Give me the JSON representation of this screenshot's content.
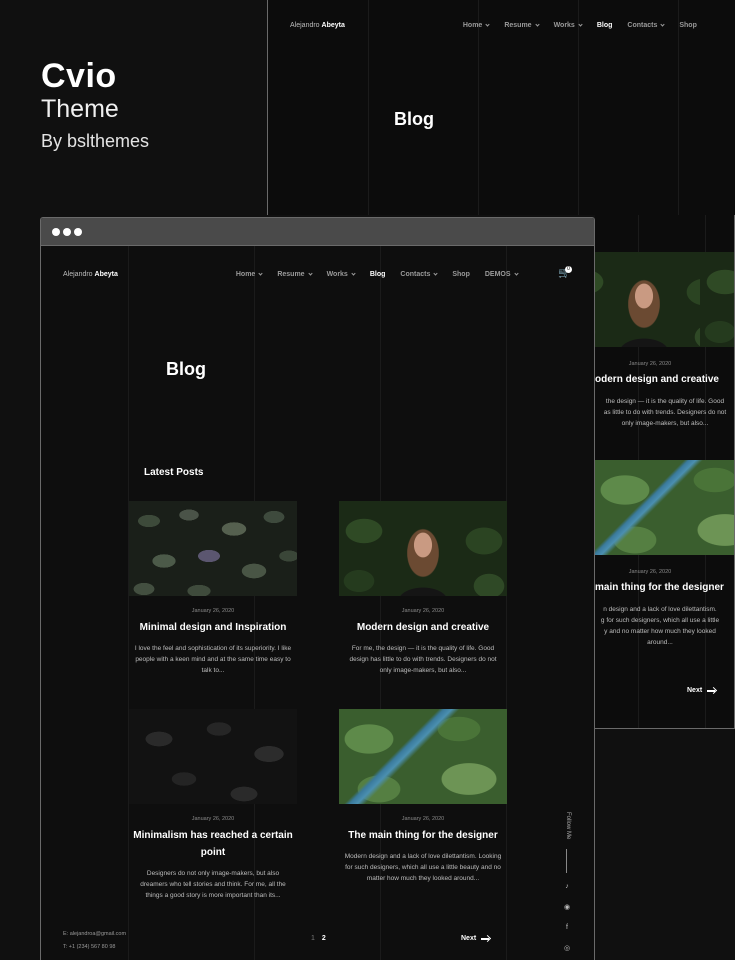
{
  "promo": {
    "brand": "Cvio",
    "theme": "Theme",
    "by": "By bslthemes"
  },
  "site": {
    "logo_first": "Alejandro",
    "logo_last": "Abeyta",
    "nav": [
      "Home",
      "Resume",
      "Works",
      "Blog",
      "Contacts",
      "Shop",
      "DEMOS"
    ],
    "active_nav": "Blog",
    "cart_count": "0",
    "page_title": "Blog",
    "section_title": "Latest Posts"
  },
  "posts": [
    {
      "date": "January 26, 2020",
      "title": "Minimal design and Inspiration",
      "excerpt": "I love the feel and sophistication of its superiority. I like people with a keen mind and at the same time easy to talk to..."
    },
    {
      "date": "January 26, 2020",
      "title": "Modern design and creative",
      "excerpt": "For me, the design — it is the quality of life. Good design has little to do with trends. Designers do not only image-makers, but also..."
    },
    {
      "date": "January 26, 2020",
      "title": "Minimalism has reached a certain point",
      "excerpt": "Designers do not only image-makers, but also dreamers who tell stories and think. For me, all the things a good story is more important than its..."
    },
    {
      "date": "January 26, 2020",
      "title": "The main thing for the designer",
      "excerpt": "Modern design and a lack of love dilettantism. Looking for such designers, which all use a little beauty and no matter how much they looked around..."
    }
  ],
  "back_posts": [
    {
      "date": "January 26, 2020",
      "title": "odern design and creative",
      "excerpt_lines": [
        "the design — it is the quality of life. Good",
        "as little to do with trends. Designers do not",
        "only image-makers, but also..."
      ]
    },
    {
      "date": "January 26, 2020",
      "title": "main thing for the designer",
      "excerpt_lines": [
        "n design and a lack of love dilettantism.",
        "g for such designers, which all use a little",
        "y and no matter how much they looked",
        "around..."
      ]
    }
  ],
  "footer": {
    "email": "E: alejandroa@gmail.com",
    "phone": "T: +1 (234) 567 80 98"
  },
  "pagination": {
    "pages": [
      "1",
      "2"
    ],
    "next": "Next"
  },
  "follow_label": "Follow Me",
  "social_icons": [
    "tiktok-icon",
    "github-icon",
    "facebook-icon",
    "instagram-icon"
  ],
  "tool_icons": [
    "eye-slash-icon",
    "support-icon",
    "cart-icon",
    "grid-icon"
  ]
}
